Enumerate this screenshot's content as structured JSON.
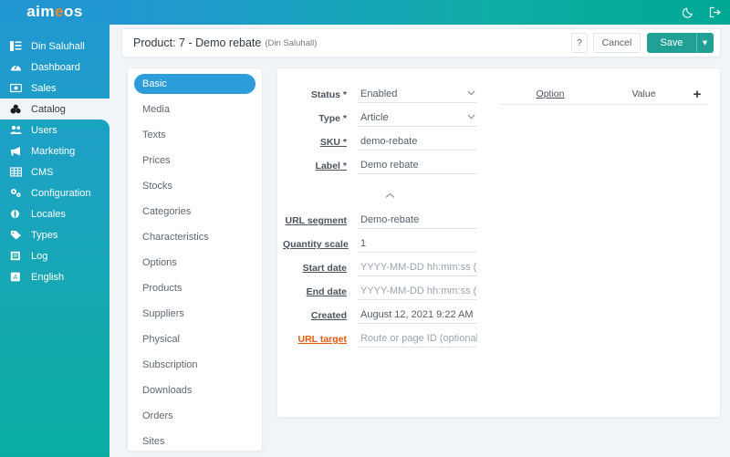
{
  "brand": {
    "name_part1": "aim",
    "name_e": "e",
    "name_part2": "os"
  },
  "topbar": {
    "theme_toggle": "dark-mode-icon",
    "logout": "logout-icon"
  },
  "sidebar": {
    "items": [
      {
        "label": "Din Saluhall",
        "icon": "list-icon",
        "active": false
      },
      {
        "label": "Dashboard",
        "icon": "dashboard-icon",
        "active": false
      },
      {
        "label": "Sales",
        "icon": "money-icon",
        "active": false
      },
      {
        "label": "Catalog",
        "icon": "catalog-icon",
        "active": true
      },
      {
        "label": "Users",
        "icon": "users-icon",
        "active": false
      },
      {
        "label": "Marketing",
        "icon": "megaphone-icon",
        "active": false
      },
      {
        "label": "CMS",
        "icon": "grid-icon",
        "active": false
      },
      {
        "label": "Configuration",
        "icon": "gears-icon",
        "active": false
      },
      {
        "label": "Locales",
        "icon": "globe-icon",
        "active": false
      },
      {
        "label": "Types",
        "icon": "tag-icon",
        "active": false
      },
      {
        "label": "Log",
        "icon": "log-icon",
        "active": false
      },
      {
        "label": "English",
        "icon": "language-icon",
        "active": false
      }
    ]
  },
  "header": {
    "title": "Product: 7 - Demo rebate",
    "subtitle": "(Din Saluhall)",
    "help_label": "?",
    "cancel_label": "Cancel",
    "save_label": "Save",
    "save_caret": "▾"
  },
  "tabs": [
    {
      "label": "Basic",
      "active": true
    },
    {
      "label": "Media",
      "active": false
    },
    {
      "label": "Texts",
      "active": false
    },
    {
      "label": "Prices",
      "active": false
    },
    {
      "label": "Stocks",
      "active": false
    },
    {
      "label": "Categories",
      "active": false
    },
    {
      "label": "Characteristics",
      "active": false
    },
    {
      "label": "Options",
      "active": false
    },
    {
      "label": "Products",
      "active": false
    },
    {
      "label": "Suppliers",
      "active": false
    },
    {
      "label": "Physical",
      "active": false
    },
    {
      "label": "Subscription",
      "active": false
    },
    {
      "label": "Downloads",
      "active": false
    },
    {
      "label": "Orders",
      "active": false
    },
    {
      "label": "Sites",
      "active": false
    }
  ],
  "form": {
    "status": {
      "label": "Status",
      "required": "*",
      "value": "Enabled",
      "type": "select"
    },
    "type": {
      "label": "Type",
      "required": "*",
      "value": "Article",
      "type": "select"
    },
    "sku": {
      "label": "SKU",
      "required": "*",
      "value": "demo-rebate",
      "type": "text"
    },
    "label_field": {
      "label": "Label",
      "required": "*",
      "value": "Demo rebate",
      "type": "text"
    },
    "collapse_icon": "chevron-up-icon",
    "url_segment": {
      "label": "URL segment",
      "value": "Demo-rebate",
      "type": "text"
    },
    "quantity_scale": {
      "label": "Quantity scale",
      "value": "1",
      "type": "text"
    },
    "start_date": {
      "label": "Start date",
      "value": "",
      "placeholder": "YYYY-MM-DD hh:mm:ss (opt",
      "type": "text"
    },
    "end_date": {
      "label": "End date",
      "value": "",
      "placeholder": "YYYY-MM-DD hh:mm:ss (opt",
      "type": "text"
    },
    "created": {
      "label": "Created",
      "value": "August 12, 2021 9:22 AM",
      "type": "readonly"
    },
    "url_target": {
      "label": "URL target",
      "value": "",
      "placeholder": "Route or page ID (optional)",
      "type": "text"
    }
  },
  "options_panel": {
    "col_option": "Option",
    "col_value": "Value",
    "add_label": "+",
    "rows": []
  },
  "colors": {
    "sidebar_top": "#2196d3",
    "sidebar_bottom": "#0aaca2",
    "accent_blue": "#2d9cdb",
    "save_teal": "#21a195",
    "orange": "#e8590c",
    "page_bg": "#f2f5f8"
  }
}
